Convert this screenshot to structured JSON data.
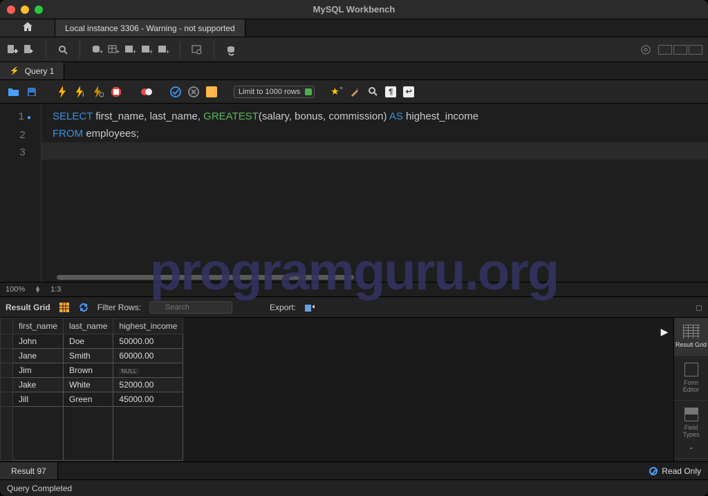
{
  "window": {
    "title": "MySQL Workbench"
  },
  "connection_tab": "Local instance 3306 - Warning - not supported",
  "query_tab": "Query 1",
  "editor_toolbar": {
    "limit": "Limit to 1000 rows"
  },
  "code": {
    "lines": [
      "SELECT first_name, last_name, GREATEST(salary, bonus, commission) AS highest_income",
      "FROM employees;",
      ""
    ]
  },
  "zoom": {
    "percent": "100%",
    "pos": "1:3"
  },
  "result_bar": {
    "label": "Result Grid",
    "filter_label": "Filter Rows:",
    "filter_placeholder": "Search",
    "export_label": "Export:"
  },
  "columns": [
    "first_name",
    "last_name",
    "highest_income"
  ],
  "rows": [
    {
      "first_name": "John",
      "last_name": "Doe",
      "highest_income": "50000.00"
    },
    {
      "first_name": "Jane",
      "last_name": "Smith",
      "highest_income": "60000.00"
    },
    {
      "first_name": "Jim",
      "last_name": "Brown",
      "highest_income": null
    },
    {
      "first_name": "Jake",
      "last_name": "White",
      "highest_income": "52000.00"
    },
    {
      "first_name": "Jill",
      "last_name": "Green",
      "highest_income": "45000.00"
    }
  ],
  "sidebar": {
    "items": [
      {
        "label": "Result Grid"
      },
      {
        "label": "Form Editor"
      },
      {
        "label": "Field Types"
      }
    ]
  },
  "result_tab": "Result 97",
  "readonly": "Read Only",
  "status": "Query Completed",
  "watermark": "programguru.org"
}
